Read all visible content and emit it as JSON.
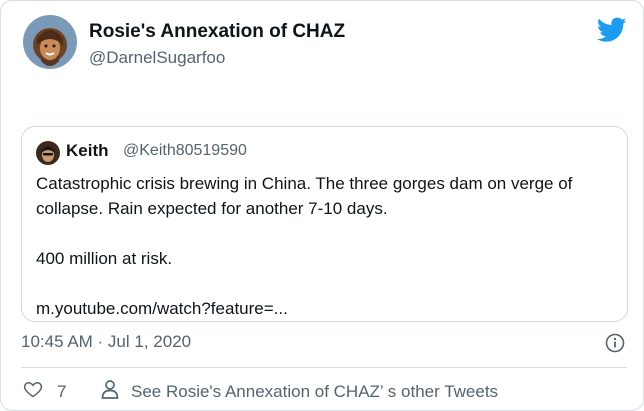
{
  "tweet": {
    "display_name": "Rosie's Annexation of CHAZ",
    "handle": "@DarnelSugarfoo",
    "timestamp": "10:45 AM · Jul 1, 2020",
    "like_count": "7",
    "other_tweets_label": "See Rosie's Annexation of CHAZ’ s other Tweets",
    "icons": {
      "brand": "twitter-bird-icon",
      "info": "info-icon",
      "like": "heart-icon",
      "profile": "person-icon"
    },
    "colors": {
      "brand_blue": "#1d9bf0",
      "secondary_text": "#536471"
    }
  },
  "quoted_tweet": {
    "name": "Keith",
    "handle": "@Keith80519590",
    "paragraphs": [
      "Catastrophic crisis brewing in China. The three gorges dam on verge of collapse. Rain expected for another 7-10 days.",
      "400 million at risk.",
      "m.youtube.com/watch?feature=..."
    ]
  }
}
